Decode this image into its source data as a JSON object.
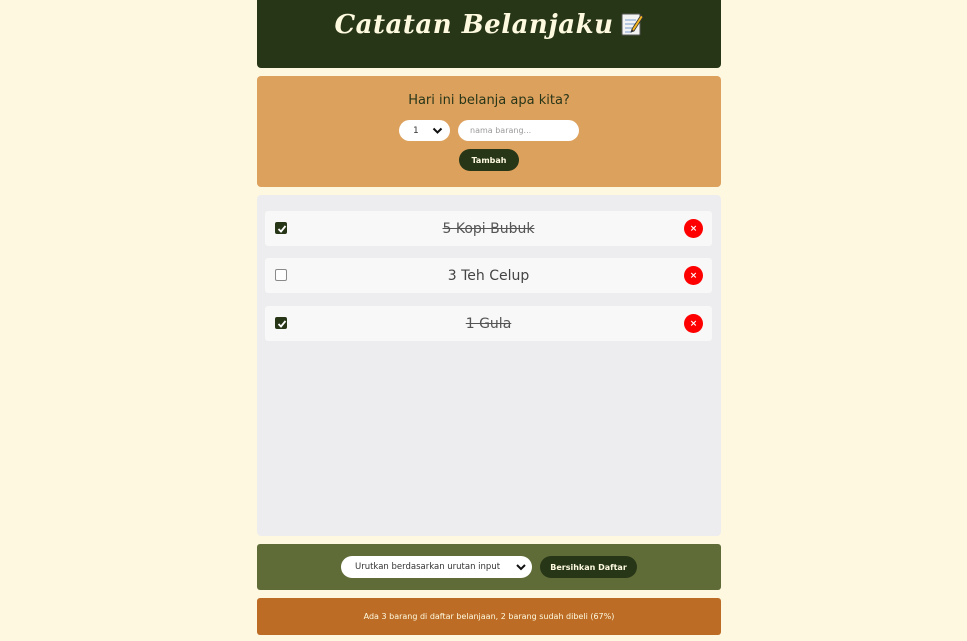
{
  "header": {
    "title": "Catatan Belanjaku",
    "title_icon": "memo-icon"
  },
  "form": {
    "question": "Hari ini belanja apa kita?",
    "quantity_value": "1",
    "name_placeholder": "nama barang...",
    "add_label": "Tambah"
  },
  "items": [
    {
      "label": "5 Kopi Bubuk",
      "checked": true
    },
    {
      "label": "3 Teh Celup",
      "checked": false
    },
    {
      "label": "1 Gula",
      "checked": true
    }
  ],
  "delete_glyph": "×",
  "controls": {
    "sort_value": "Urutkan berdasarkan urutan input",
    "clear_label": "Bersihkan Daftar"
  },
  "stats": {
    "text": "Ada 3 barang di daftar belanjaan, 2 barang sudah dibeli (67%)"
  },
  "colors": {
    "header_bg": "#283618",
    "form_bg": "#DDA15E",
    "list_bg": "#EDEDEF",
    "controls_bg": "#606C38",
    "stats_bg": "#BC6C25",
    "delete_red": "#FF0000",
    "page_bg": "#FFF8E1"
  }
}
